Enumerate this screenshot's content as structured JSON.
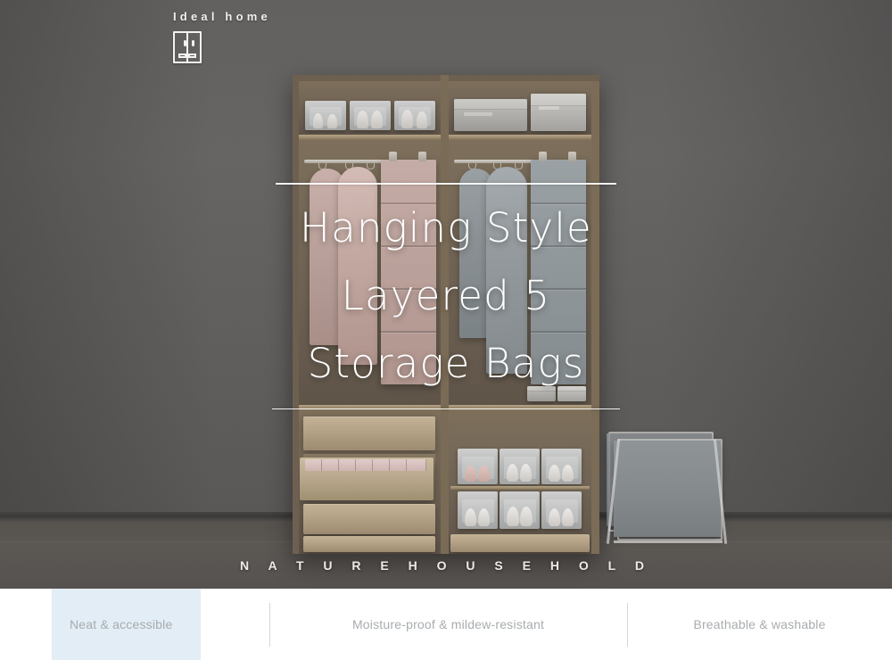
{
  "brand": {
    "name": "Ideal home",
    "logo_icon": "wardrobe-cabinet-icon"
  },
  "hero": {
    "title_lines": [
      "Hanging Style",
      "Layered 5",
      "Storage Bags"
    ],
    "tagline": "N A T U R E     H O U S E H O L D",
    "rule_color": "#ffffff",
    "title_color": "#ffffff",
    "background_color": "#5d5d5d"
  },
  "scene": {
    "description": "wardrobe-interior-photo",
    "items": [
      "shoe-boxes-top-left",
      "storage-boxes-top-right",
      "garment-bags-pink",
      "garment-bags-grey",
      "hanging-organizer-pink",
      "hanging-organizer-grey",
      "wooden-drawers",
      "clear-shoe-boxes",
      "laundry-hamper"
    ]
  },
  "features": {
    "accent_color": "#e2edf5",
    "text_color": "#a8acaf",
    "items": [
      {
        "label": "Neat & accessible",
        "active": true
      },
      {
        "label": "Moisture-proof & mildew-resistant",
        "active": false
      },
      {
        "label": "Breathable & washable",
        "active": false
      }
    ]
  }
}
